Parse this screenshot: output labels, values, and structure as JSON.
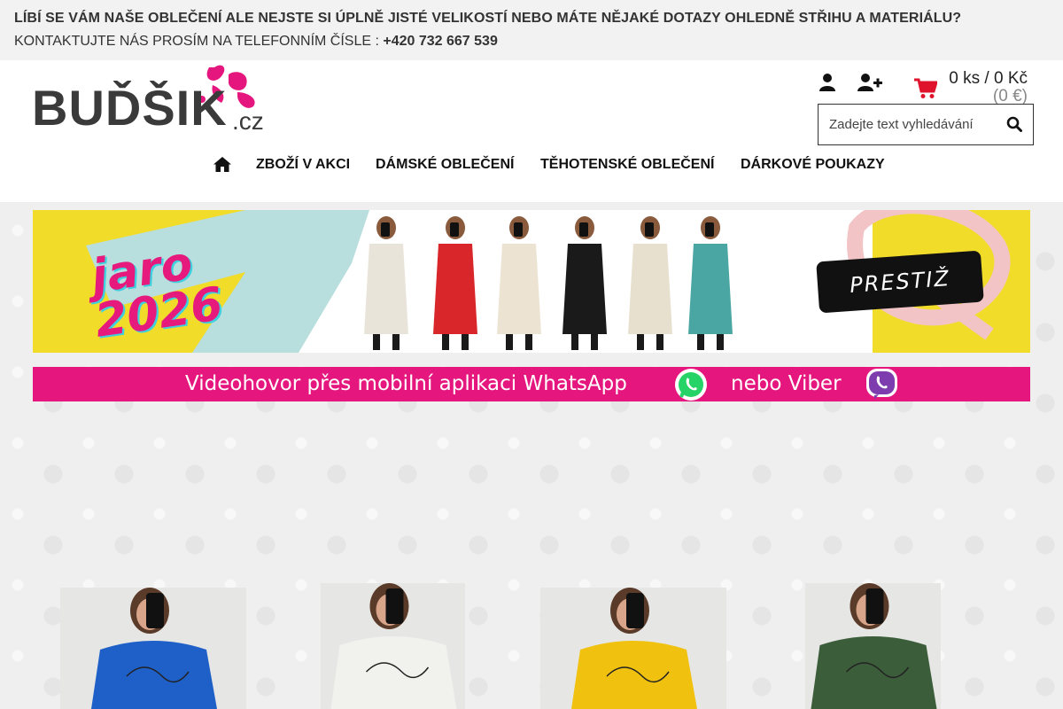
{
  "notice": {
    "line1": "LÍBÍ SE VÁM NAŠE OBLEČENÍ ALE NEJSTE SI ÚPLNĚ JISTÉ VELIKOSTÍ NEBO MÁTE NĚJAKÉ DOTAZY OHLEDNĚ STŘIHU A MATERIÁLU?",
    "line2_prefix": "KONTAKTUJTE NÁS PROSÍM NA TELEFONNÍM ČÍSLE : ",
    "phone": "+420 732 667 539"
  },
  "logo": {
    "word": "BUĎŠIK",
    "tld": ".cz"
  },
  "header": {
    "icons": [
      "user-icon",
      "user-plus-icon",
      "shopping-cart-icon",
      "search-icon",
      "home-icon"
    ],
    "cart": {
      "count": "0 ks / 0 Kč",
      "eur": "(0 €)"
    },
    "search": {
      "placeholder": "Zadejte text vyhledávání"
    }
  },
  "nav": {
    "items": [
      {
        "label": "ZBOŽÍ V AKCI"
      },
      {
        "label": "DÁMSKÉ OBLEČENÍ"
      },
      {
        "label": "TĚHOTENSKÉ OBLEČENÍ"
      },
      {
        "label": "DÁRKOVÉ POUKAZY"
      }
    ]
  },
  "banner": {
    "spring_line1": "jaro",
    "spring_line2": "2026",
    "brand_badge": "PRESTIŽ",
    "model_outfit_colors": [
      "#e9e4da",
      "#d9262b",
      "#ece3d2",
      "#1a1a1a",
      "#e8e0cf",
      "#4aa6a2"
    ]
  },
  "video_strip": {
    "text": "Videohovor přes mobilní aplikaci WhatsApp",
    "or_text": "nebo Viber"
  },
  "products": [
    {
      "dress_color": "#1f5fc8"
    },
    {
      "dress_color": "#f1f1ee"
    },
    {
      "dress_color": "#f1c110"
    },
    {
      "dress_color": "#3b5d3a"
    }
  ],
  "colors": {
    "accent_pink": "#e5177e",
    "cart_red": "#e0132c",
    "banner_yellow": "#f2dc2a",
    "banner_mint": "#b8dedd"
  }
}
